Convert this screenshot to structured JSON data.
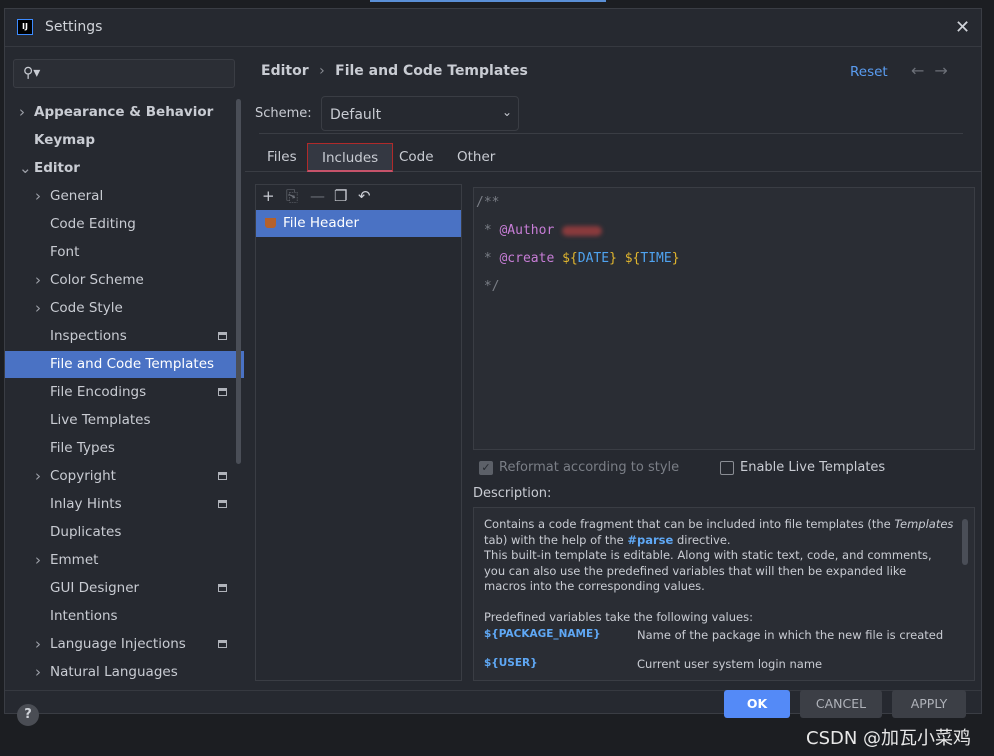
{
  "window": {
    "title": "Settings",
    "logo": "IJ",
    "close_icon": "close-icon"
  },
  "search": {
    "placeholder": "",
    "icon": "search-icon"
  },
  "sidebar": {
    "items": [
      {
        "label": "Appearance & Behavior",
        "bold": true,
        "chevron": "right",
        "level": 0
      },
      {
        "label": "Keymap",
        "bold": true,
        "level": 0
      },
      {
        "label": "Editor",
        "bold": true,
        "chevron": "down",
        "level": 0
      },
      {
        "label": "General",
        "chevron": "right",
        "level": 1
      },
      {
        "label": "Code Editing",
        "level": 1
      },
      {
        "label": "Font",
        "level": 1
      },
      {
        "label": "Color Scheme",
        "chevron": "right",
        "level": 1
      },
      {
        "label": "Code Style",
        "chevron": "right",
        "level": 1
      },
      {
        "label": "Inspections",
        "level": 1,
        "settings_icon": true
      },
      {
        "label": "File and Code Templates",
        "level": 1,
        "selected": true
      },
      {
        "label": "File Encodings",
        "level": 1,
        "settings_icon": true
      },
      {
        "label": "Live Templates",
        "level": 1
      },
      {
        "label": "File Types",
        "level": 1
      },
      {
        "label": "Copyright",
        "chevron": "right",
        "level": 1,
        "settings_icon": true
      },
      {
        "label": "Inlay Hints",
        "level": 1,
        "settings_icon": true
      },
      {
        "label": "Duplicates",
        "level": 1
      },
      {
        "label": "Emmet",
        "chevron": "right",
        "level": 1
      },
      {
        "label": "GUI Designer",
        "level": 1,
        "settings_icon": true
      },
      {
        "label": "Intentions",
        "level": 1
      },
      {
        "label": "Language Injections",
        "chevron": "right",
        "level": 1,
        "settings_icon": true
      },
      {
        "label": "Natural Languages",
        "chevron": "right",
        "level": 1
      }
    ]
  },
  "breadcrumb": {
    "parent": "Editor",
    "separator": "›",
    "current": "File and Code Templates"
  },
  "header": {
    "reset": "Reset",
    "back": "←",
    "forward": "→"
  },
  "scheme": {
    "label": "Scheme:",
    "value": "Default"
  },
  "tabs": [
    {
      "label": "Files"
    },
    {
      "label": "Includes",
      "active": true
    },
    {
      "label": "Code"
    },
    {
      "label": "Other"
    }
  ],
  "list": {
    "toolbar": [
      "add-icon",
      "copy-add-icon",
      "remove-icon",
      "duplicate-icon",
      "revert-icon"
    ],
    "items": [
      {
        "label": "File Header",
        "selected": true
      }
    ]
  },
  "editor": {
    "lines": [
      [
        {
          "t": "/**",
          "c": "cm"
        }
      ],
      [
        {
          "t": " * ",
          "c": "cm"
        },
        {
          "t": "@Author",
          "c": "at"
        },
        {
          "t": " ",
          "c": "cm"
        },
        {
          "t": "",
          "c": "blur"
        }
      ],
      [
        {
          "t": " * ",
          "c": "cm"
        },
        {
          "t": "@create",
          "c": "at"
        },
        {
          "t": " ",
          "c": "cm"
        },
        {
          "t": "${",
          "c": "dol"
        },
        {
          "t": "DATE",
          "c": "var"
        },
        {
          "t": "}",
          "c": "dol"
        },
        {
          "t": " ",
          "c": "cm"
        },
        {
          "t": "${",
          "c": "dol"
        },
        {
          "t": "TIME",
          "c": "var"
        },
        {
          "t": "}",
          "c": "dol"
        }
      ],
      [
        {
          "t": " */",
          "c": "cm"
        }
      ]
    ]
  },
  "options": {
    "reformat": {
      "label": "Reformat according to style",
      "checked": true,
      "disabled": true
    },
    "live_templates": {
      "label": "Enable Live Templates",
      "checked": false
    }
  },
  "description": {
    "label": "Description:",
    "p1a": "Contains a code fragment that can be included into file templates (the ",
    "p1b": "Templates",
    "p1c": " tab) with the help of the ",
    "p1d": "#parse",
    "p1e": " directive.",
    "p2": "This built-in template is editable. Along with static text, code, and comments, you can also use the predefined variables that will then be expanded like macros into the corresponding values.",
    "p3": "Predefined variables take the following values:",
    "vars": [
      {
        "name": "${PACKAGE_NAME}",
        "desc": "Name of the package in which the new file is created"
      },
      {
        "name": "${USER}",
        "desc": "Current user system login name"
      }
    ]
  },
  "footer": {
    "help": "?",
    "ok": "OK",
    "cancel": "CANCEL",
    "apply": "APPLY"
  },
  "watermark": "CSDN @加瓦小菜鸡",
  "colors": {
    "accent": "#4a72c4",
    "ok_button": "#548af7",
    "link": "#5a9cf0",
    "tab_highlight": "#b02a2a"
  }
}
